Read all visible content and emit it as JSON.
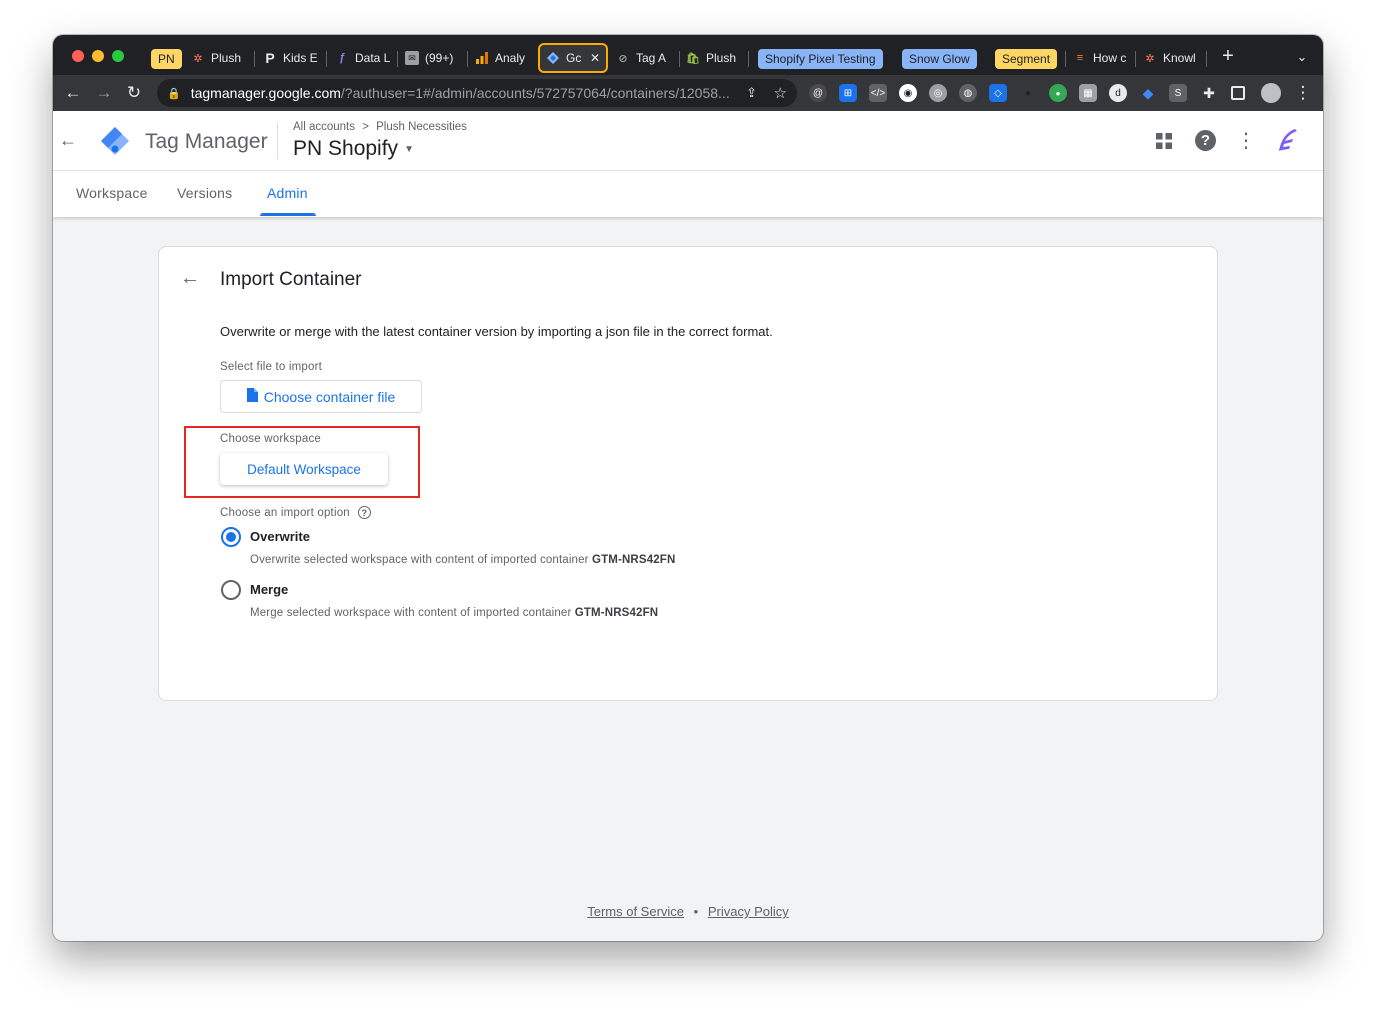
{
  "browser": {
    "tabs": [
      {
        "label": "PN",
        "type": "group-chip",
        "color": "#fdd663"
      },
      {
        "label": "Plush",
        "icon": "hubspot-icon"
      },
      {
        "label": "Kids E",
        "icon": "p-icon"
      },
      {
        "label": "Data L",
        "icon": "feather-icon"
      },
      {
        "label": "(99+)",
        "icon": "mail-icon"
      },
      {
        "label": "Analy",
        "icon": "analytics-icon"
      },
      {
        "label": "Gc",
        "icon": "gtm-icon",
        "active": true
      },
      {
        "label": "Tag A",
        "icon": "tag-assistant-icon"
      },
      {
        "label": "Plush",
        "icon": "shopify-icon"
      },
      {
        "label": "Shopify Pixel Testing",
        "type": "group-chip",
        "color": "#8ab4f8"
      },
      {
        "label": "Snow Glow",
        "type": "group-chip",
        "color": "#8ab4f8"
      },
      {
        "label": "Segment",
        "type": "group-chip",
        "color": "#fdd663"
      },
      {
        "label": "How c",
        "icon": "stack-icon"
      },
      {
        "label": "Knowl",
        "icon": "hubspot-icon"
      }
    ],
    "url_host": "tagmanager.google.com",
    "url_path": "/?authuser=1#/admin/accounts/572757064/containers/12058..."
  },
  "gtm": {
    "product_name": "Tag Manager",
    "breadcrumb_root": "All accounts",
    "breadcrumb_separator": ">",
    "breadcrumb_account": "Plush Necessities",
    "container_name": "PN Shopify",
    "nav_tabs": [
      "Workspace",
      "Versions",
      "Admin"
    ]
  },
  "import": {
    "title": "Import Container",
    "description": "Overwrite or merge with the latest container version by importing a json file in the correct format.",
    "select_file_label": "Select file to import",
    "choose_file_button": "Choose container file",
    "choose_workspace_label": "Choose workspace",
    "workspace_button": "Default Workspace",
    "import_option_label": "Choose an import option",
    "options": [
      {
        "label": "Overwrite",
        "desc_prefix": "Overwrite selected workspace with content of imported container ",
        "container_id": "GTM-NRS42FN",
        "selected": true
      },
      {
        "label": "Merge",
        "desc_prefix": "Merge selected workspace with content of imported container ",
        "container_id": "GTM-NRS42FN",
        "selected": false
      }
    ]
  },
  "footer": {
    "terms": "Terms of Service",
    "separator": "•",
    "privacy": "Privacy Policy"
  },
  "colors": {
    "accent": "#1a73e8",
    "highlight_box": "#e2291f",
    "active_tab_border": "#f9ab00"
  }
}
